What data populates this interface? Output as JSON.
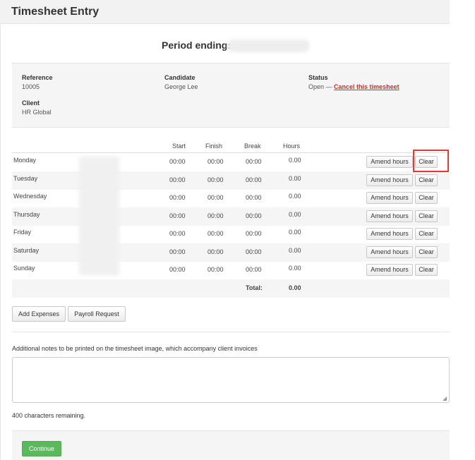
{
  "page": {
    "title": "Timesheet Entry",
    "period_label": "Period ending:"
  },
  "info": {
    "reference_label": "Reference",
    "reference_value": "10005",
    "candidate_label": "Candidate",
    "candidate_value": "George Lee",
    "status_label": "Status",
    "status_value": "Open —",
    "cancel_link": "Cancel this timesheet",
    "client_label": "Client",
    "client_value": "HR Global"
  },
  "table": {
    "headers": [
      "Start",
      "Finish",
      "Break",
      "Hours"
    ],
    "rows": [
      {
        "day": "Monday",
        "start": "00:00",
        "finish": "00:00",
        "break": "00:00",
        "hours": "0.00"
      },
      {
        "day": "Tuesday",
        "start": "00:00",
        "finish": "00:00",
        "break": "00:00",
        "hours": "0.00"
      },
      {
        "day": "Wednesday",
        "start": "00:00",
        "finish": "00:00",
        "break": "00:00",
        "hours": "0.00"
      },
      {
        "day": "Thursday",
        "start": "00:00",
        "finish": "00:00",
        "break": "00:00",
        "hours": "0.00"
      },
      {
        "day": "Friday",
        "start": "00:00",
        "finish": "00:00",
        "break": "00:00",
        "hours": "0.00"
      },
      {
        "day": "Saturday",
        "start": "00:00",
        "finish": "00:00",
        "break": "00:00",
        "hours": "0.00"
      },
      {
        "day": "Sunday",
        "start": "00:00",
        "finish": "00:00",
        "break": "00:00",
        "hours": "0.00"
      }
    ],
    "amend_label": "Amend hours",
    "clear_label": "Clear",
    "total_label": "Total:",
    "total_value": "0.00"
  },
  "actions": {
    "add_expenses": "Add Expenses",
    "payroll_request": "Payroll Request"
  },
  "notes": {
    "label": "Additional notes to be printed on the timesheet image, which accompany client invoices",
    "value": "",
    "chars_remaining": "400 characters remaining."
  },
  "footer": {
    "continue_label": "Continue"
  },
  "colors": {
    "accent_green": "#5cb85c",
    "link_red": "#c9302c",
    "highlight_red": "#e53935"
  }
}
